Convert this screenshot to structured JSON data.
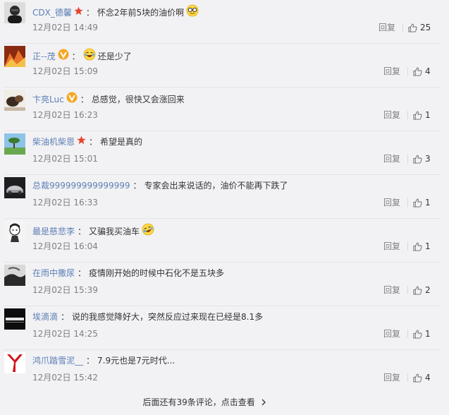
{
  "reply_label": "回复",
  "comments": [
    {
      "username": "CDX_德馨",
      "badge": "star",
      "text": "怀念2年前5块的油价啊",
      "emoji": "glasses-face",
      "time": "12月02日 14:49",
      "likes": "25"
    },
    {
      "username": "正--茂",
      "badge": "vip",
      "text": "还是少了",
      "emoji": "laugh-cry",
      "time": "12月02日 15:09",
      "likes": "4"
    },
    {
      "username": "卞亮Luc",
      "badge": "vip",
      "text": "总感觉，很快又会涨回来",
      "emoji": "",
      "time": "12月02日 16:23",
      "likes": "1"
    },
    {
      "username": "柴油机柴恩",
      "badge": "star",
      "text": "希望是真的",
      "emoji": "",
      "time": "12月02日 15:01",
      "likes": "3"
    },
    {
      "username": "总裁999999999999999",
      "badge": "",
      "text": "专家会出来说话的，油价不能再下跌了",
      "emoji": "",
      "time": "12月02日 16:33",
      "likes": "1"
    },
    {
      "username": "最是慈悲李",
      "badge": "",
      "text": "又骗我买油车",
      "emoji": "laugh-cry-tilt",
      "time": "12月02日 16:04",
      "likes": "1"
    },
    {
      "username": "在雨中撒尿",
      "badge": "",
      "text": "疫情刚开始的时候中石化不是五块多",
      "emoji": "",
      "time": "12月02日 15:39",
      "likes": "2"
    },
    {
      "username": "埃滴滴",
      "badge": "",
      "text": "说的我感觉降好大，突然反应过来现在已经是8.1多",
      "emoji": "",
      "time": "12月02日 14:25",
      "likes": "1"
    },
    {
      "username": "鸿爪踏雪泥__",
      "badge": "",
      "text": "7.9元也是7元时代...",
      "emoji": "",
      "time": "12月02日 15:42",
      "likes": "4"
    }
  ],
  "more_text": "后面还有39条评论，点击查看",
  "colors": {
    "username": "#5d7fb3",
    "badge_star": "#e8412b",
    "badge_vip": "#f5a623",
    "time": "#808080"
  }
}
